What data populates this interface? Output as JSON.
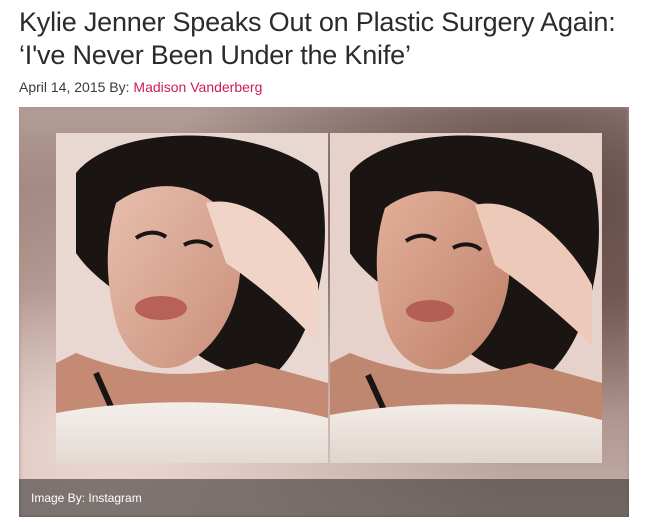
{
  "article": {
    "title": "Kylie Jenner Speaks Out on Plastic Surgery Again: ‘I've Never Been Under the Knife’",
    "date": "April 14, 2015",
    "by_label": "By:",
    "author": "Madison Vanderberg"
  },
  "image": {
    "caption": "Image By: Instagram",
    "accent_hair": "#1a1412",
    "accent_skin": "#d9a591",
    "accent_lips": "#b8615a"
  }
}
